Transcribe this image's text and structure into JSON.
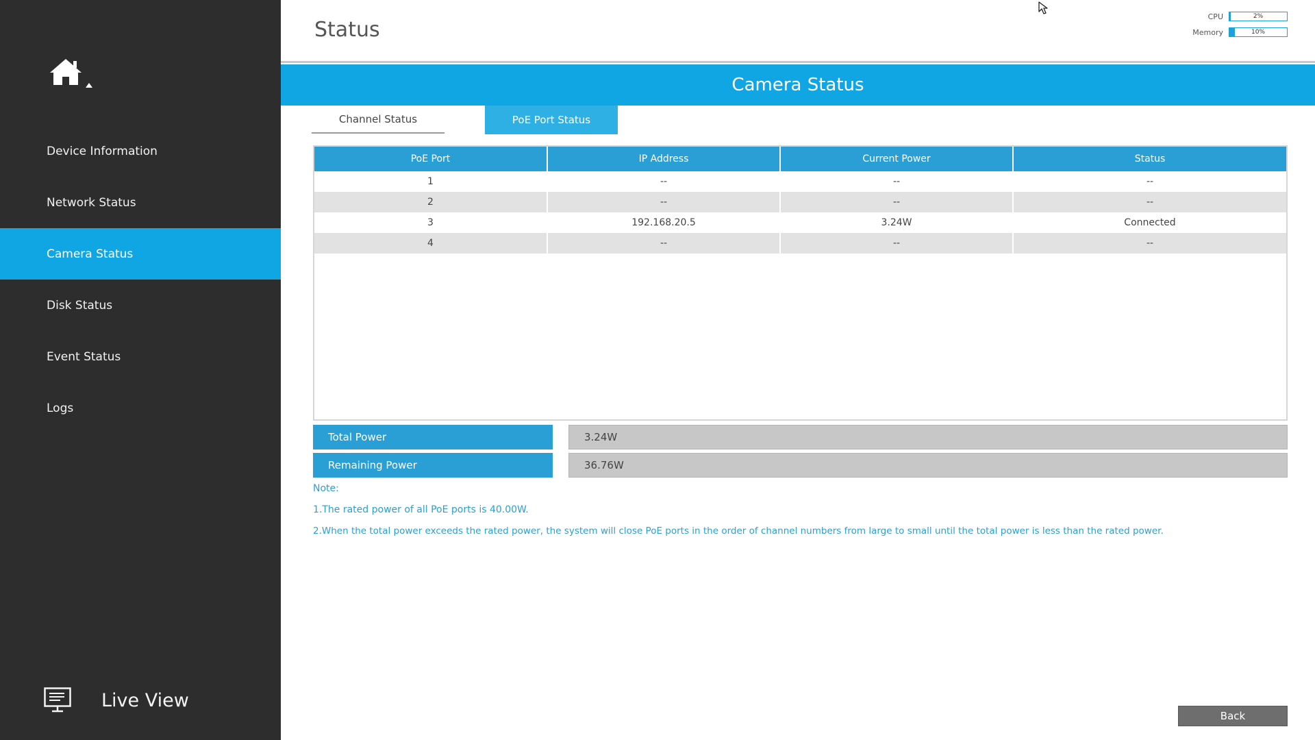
{
  "sidebar": {
    "items": [
      {
        "label": "Device Information"
      },
      {
        "label": "Network Status"
      },
      {
        "label": "Camera Status",
        "active": true
      },
      {
        "label": "Disk Status"
      },
      {
        "label": "Event Status"
      },
      {
        "label": "Logs"
      }
    ],
    "live_view_label": "Live View"
  },
  "header": {
    "title": "Status",
    "cpu": {
      "label": "CPU",
      "value": "2%",
      "percent": 2
    },
    "memory": {
      "label": "Memory",
      "value": "10%",
      "percent": 10
    }
  },
  "main": {
    "banner_title": "Camera Status",
    "tabs": [
      {
        "label": "Channel Status",
        "active": false
      },
      {
        "label": "PoE Port Status",
        "active": true
      }
    ],
    "table": {
      "columns": [
        "PoE Port",
        "IP Address",
        "Current Power",
        "Status"
      ],
      "rows": [
        [
          "1",
          "--",
          "--",
          "--"
        ],
        [
          "2",
          "--",
          "--",
          "--"
        ],
        [
          "3",
          "192.168.20.5",
          "3.24W",
          "Connected"
        ],
        [
          "4",
          "--",
          "--",
          "--"
        ]
      ]
    },
    "total_power": {
      "label": "Total Power",
      "value": "3.24W"
    },
    "remaining_power": {
      "label": "Remaining Power",
      "value": "36.76W"
    },
    "notes": {
      "heading": "Note:",
      "line1": "1.The rated power of all PoE ports is 40.00W.",
      "line2": "2.When the total power exceeds the rated power, the system will close PoE ports in the order of channel numbers from large to small until the total power is less than the rated power."
    },
    "back_label": "Back"
  },
  "colors": {
    "accent": "#10a6e3",
    "sidebar_bg": "#2d2d2d",
    "table_header": "#2a9fd6"
  }
}
